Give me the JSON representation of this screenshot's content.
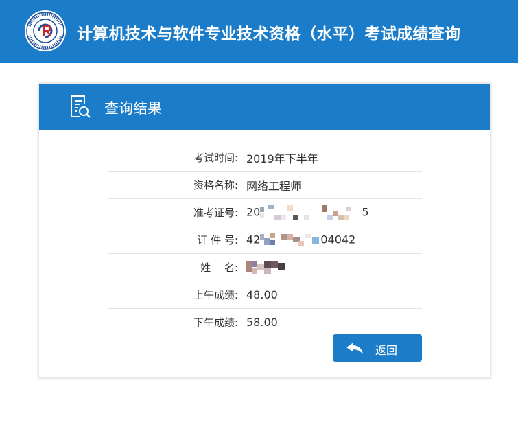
{
  "header": {
    "title": "计算机技术与软件专业技术资格（水平）考试成绩查询",
    "logo_letters": "CR",
    "logo_ring_text": "中国计算机技术职业资格网 Computer Qualification Certification"
  },
  "card": {
    "title": "查询结果",
    "rows": [
      {
        "label": "考试时间:",
        "value": "2019年下半年"
      },
      {
        "label": "资格名称:",
        "value": "网络工程师"
      },
      {
        "label": "准考证号:",
        "value_prefix": "20",
        "value_suffix": "5"
      },
      {
        "label": "证 件 号:",
        "value_prefix": "42",
        "value_suffix": "04042"
      },
      {
        "label": "姓　 名:"
      },
      {
        "label": "上午成绩:",
        "value": "48.00"
      },
      {
        "label": "下午成绩:",
        "value": "58.00"
      }
    ],
    "back_button": {
      "label": "返回"
    }
  },
  "colors": {
    "primary": "#1b7dc9",
    "text": "#333333"
  }
}
